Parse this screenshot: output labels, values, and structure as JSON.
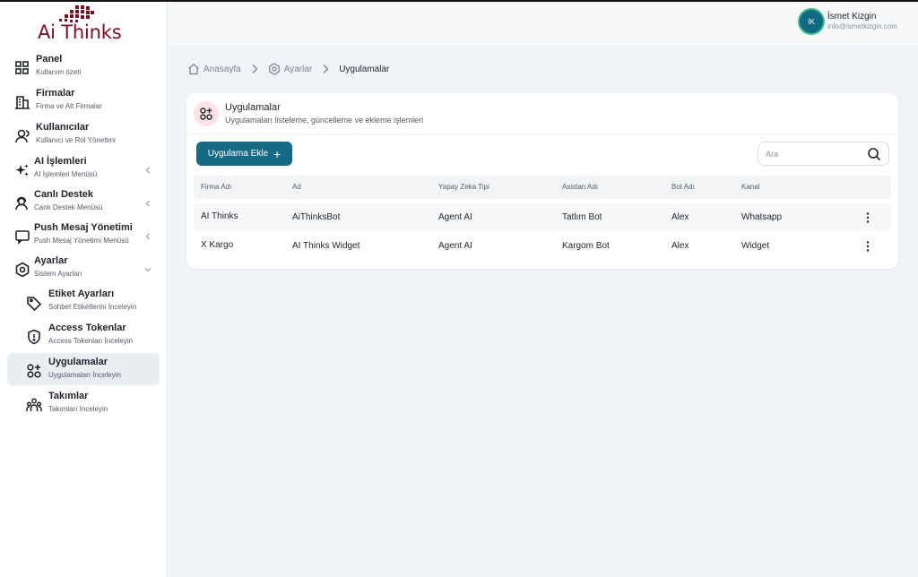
{
  "brand": {
    "name": "Ai Thinks",
    "color": "#7a1020"
  },
  "sidebar": {
    "items": [
      {
        "title": "Panel",
        "sub": "Kullanım özeti",
        "icon": "dashboard-icon"
      },
      {
        "title": "Firmalar",
        "sub": "Firma ve Alt Firmalar",
        "icon": "building-icon"
      },
      {
        "title": "Kullanıcılar",
        "sub": "Kullanıcı ve Rol Yönetimi",
        "icon": "users-icon"
      },
      {
        "title": "AI İşlemleri",
        "sub": "AI İşlemleri Menüsü",
        "icon": "sparkle-icon"
      },
      {
        "title": "Canlı Destek",
        "sub": "Canlı Destek Menüsü",
        "icon": "support-icon"
      },
      {
        "title": "Push Mesaj Yönetimi",
        "sub": "Push Mesaj Yönetimi Menüsü",
        "icon": "message-icon"
      },
      {
        "title": "Ayarlar",
        "sub": "Sistem Ayarları",
        "icon": "settings-icon"
      }
    ],
    "subitems": [
      {
        "title": "Etiket Ayarları",
        "sub": "Sohbet Etiketlerini İnceleyin",
        "icon": "tag-icon"
      },
      {
        "title": "Access Tokenlar",
        "sub": "Access Tokenları İnceleyin",
        "icon": "shield-icon"
      },
      {
        "title": "Uygulamalar",
        "sub": "Uygulamaları İnceleyin",
        "icon": "apps-icon"
      },
      {
        "title": "Takımlar",
        "sub": "Takımları İnceleyin",
        "icon": "team-icon"
      }
    ]
  },
  "user": {
    "initials": "İK",
    "name": "İsmet Kizgin",
    "email": "info@ismetkizgin.com"
  },
  "breadcrumb": {
    "home": "Anasayfa",
    "settings": "Ayarlar",
    "current": "Uygulamalar"
  },
  "page": {
    "title": "Uygulamalar",
    "subtitle": "Uygulamaları listeleme, güncelleme ve ekleme işlemleri",
    "add_button": "Uygulama Ekle",
    "search_placeholder": "Ara"
  },
  "table": {
    "columns": [
      "Firma Adı",
      "Ad",
      "Yapay Zeka Tipi",
      "Asistan Adı",
      "Bot Adı",
      "Kanal"
    ],
    "rows": [
      [
        "AI Thinks",
        "AiThinksBot",
        "Agent AI",
        "Tatlım Bot",
        "Alex",
        "Whatsapp"
      ],
      [
        "X Kargo",
        "AI Thinks Widget",
        "Agent AI",
        "Kargom Bot",
        "Alex",
        "Widget"
      ]
    ]
  },
  "colors": {
    "primary": "#176a85",
    "accent_bg": "#fde2e8",
    "avatar_ring": "#3fbf8a"
  }
}
